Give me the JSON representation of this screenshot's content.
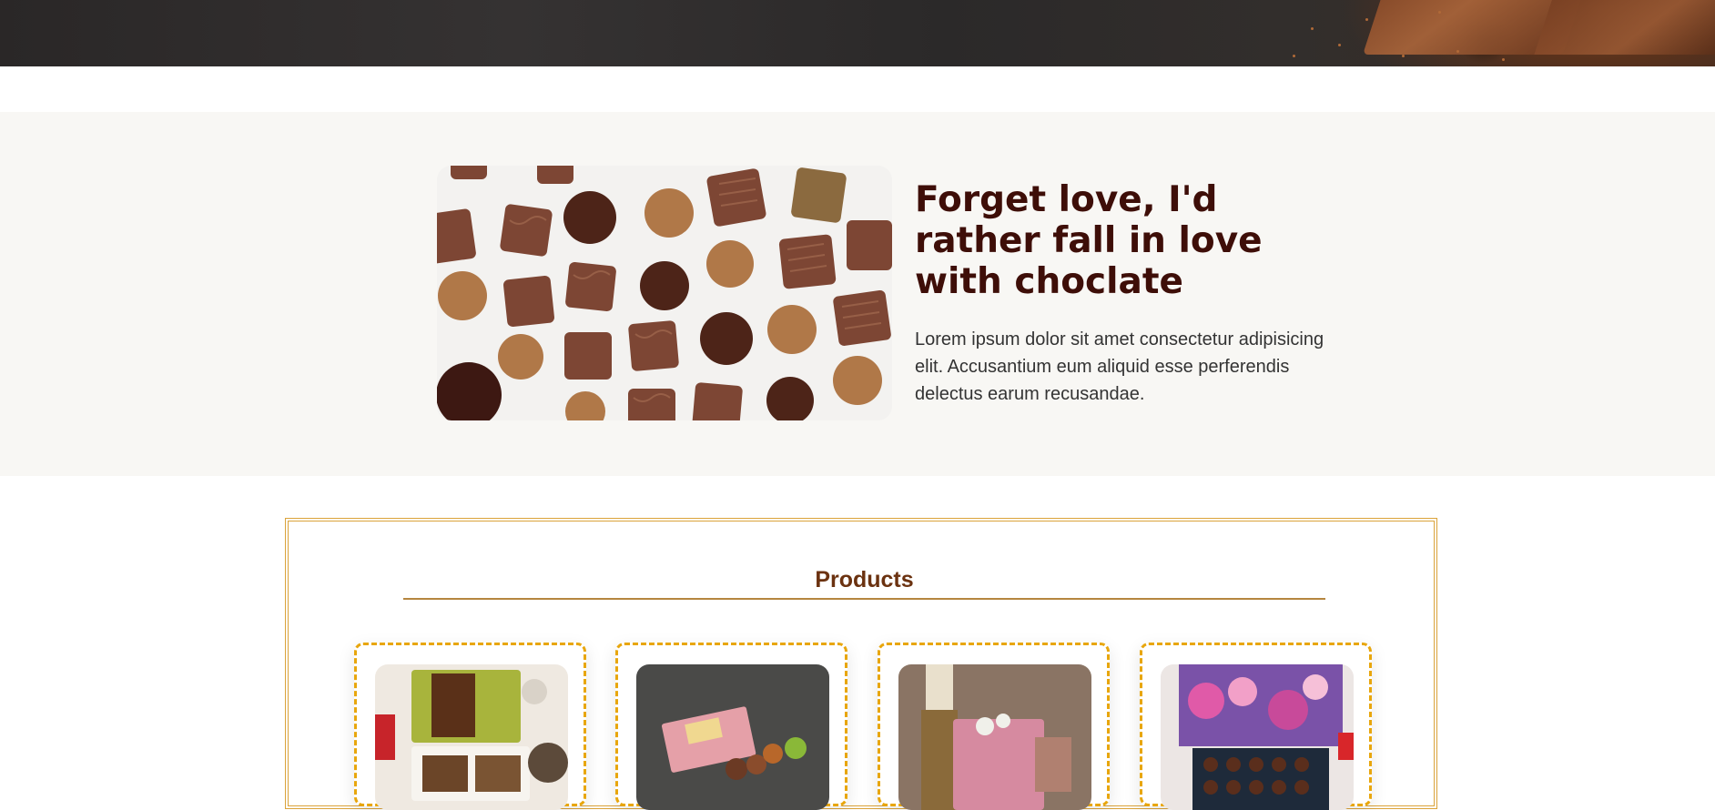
{
  "intro": {
    "heading": "Forget love, I'd rather fall in love with choclate",
    "body": "Lorem ipsum dolor sit amet consectetur adipisicing elit. Accusantium eum aliquid esse perferendis delectus earum recusandae."
  },
  "products": {
    "title": "Products"
  },
  "colors": {
    "heading": "#3e0e08",
    "products_title": "#6b3210",
    "accent_border": "#e8a60c",
    "section_bg": "#f8f7f4"
  }
}
